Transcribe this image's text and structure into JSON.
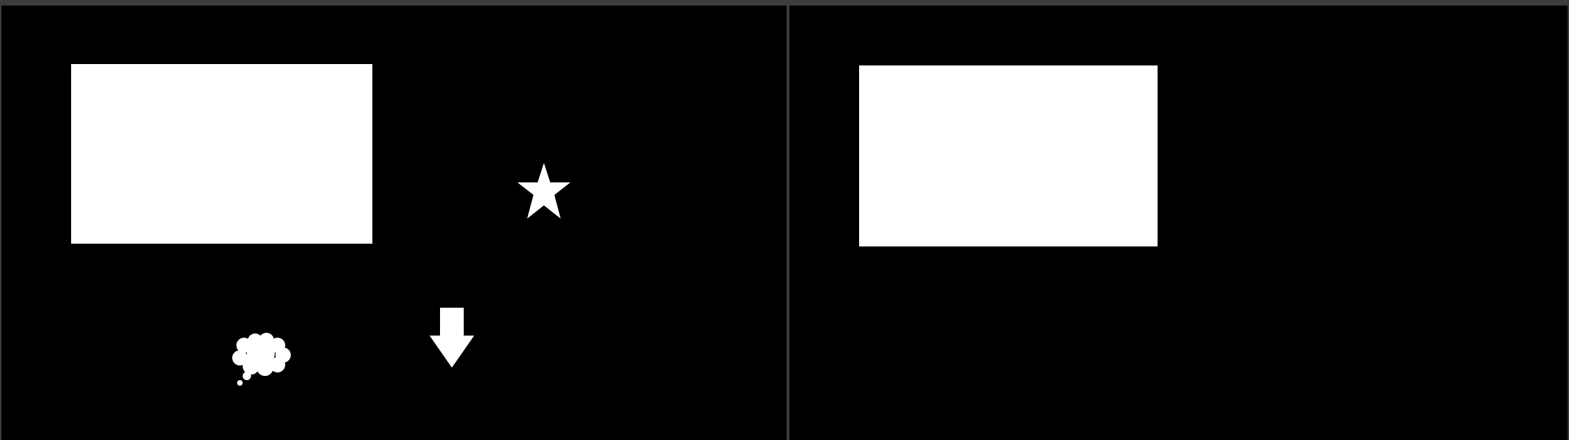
{
  "colors": {
    "canvas_background": "#000000",
    "shape_fill": "#ffffff",
    "frame": "#3c3c3c"
  },
  "panels": [
    {
      "id": "left",
      "shapes": [
        "rectangle",
        "star-icon",
        "cloud-icon",
        "down-arrow-icon"
      ]
    },
    {
      "id": "right",
      "shapes": [
        "rectangle"
      ]
    }
  ]
}
